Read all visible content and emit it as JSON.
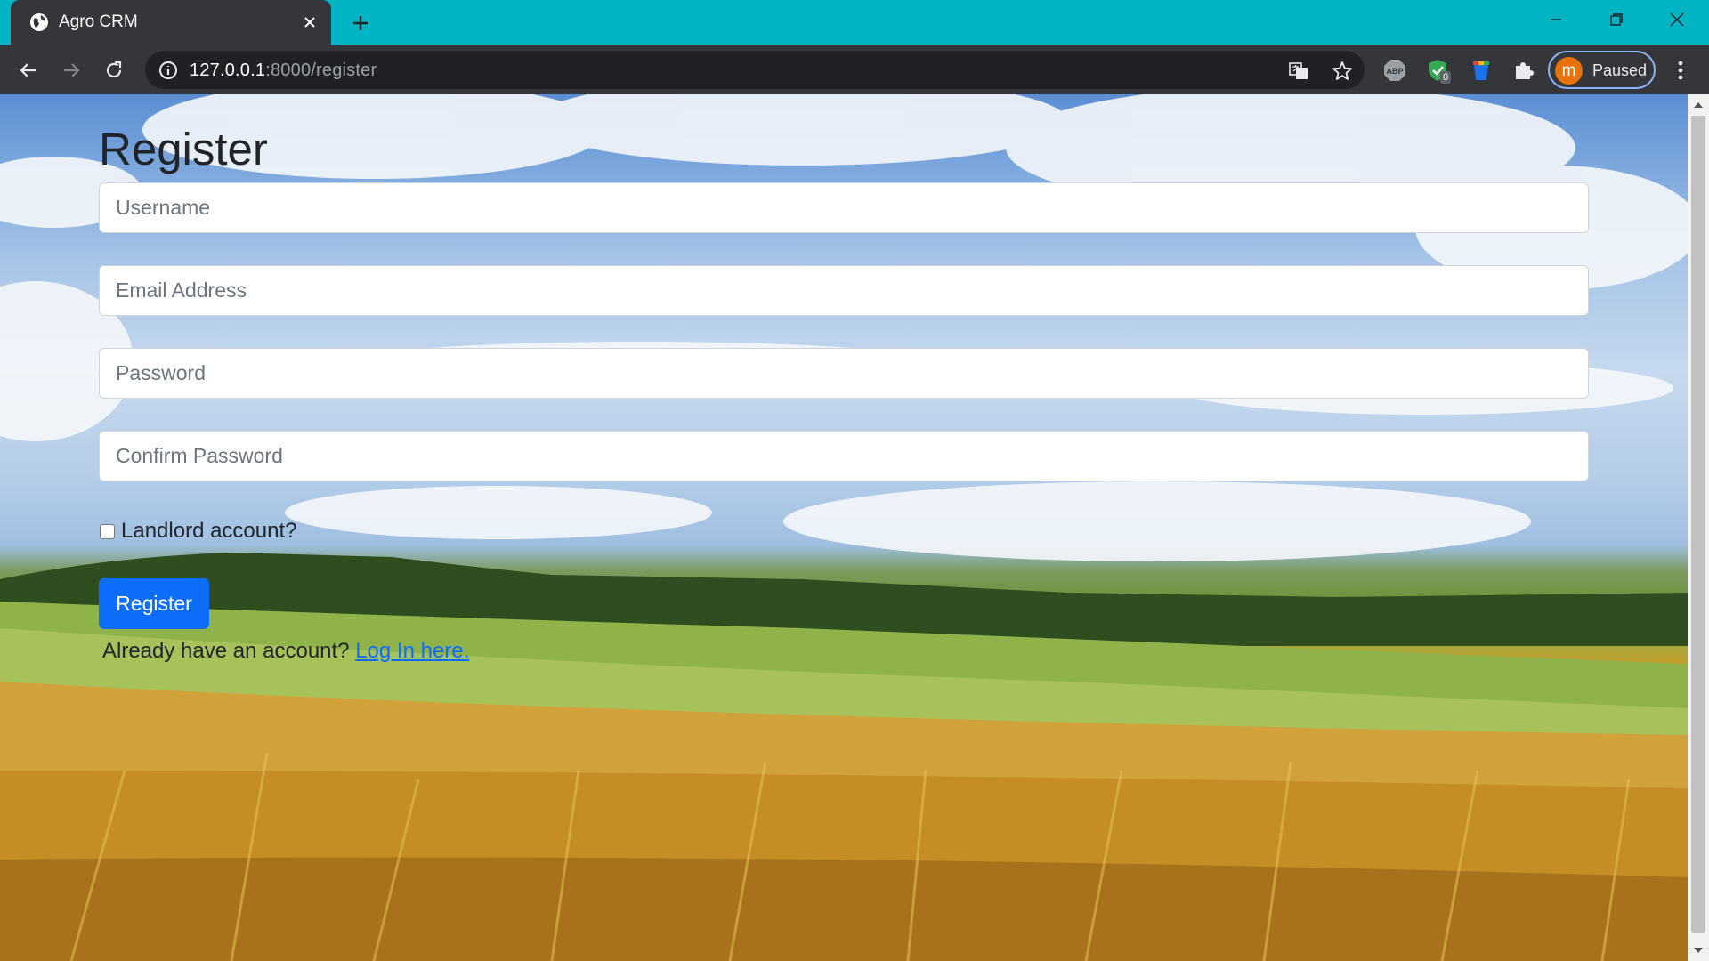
{
  "browser": {
    "tab_title": "Agro CRM",
    "url_host": "127.0.0.1",
    "url_path": ":8000/register",
    "profile_initial": "m",
    "profile_status": "Paused",
    "extension_badge": "0",
    "accent_color": "#01b4c4"
  },
  "page": {
    "title": "Register",
    "fields": {
      "username_placeholder": "Username",
      "email_placeholder": "Email Address",
      "password_placeholder": "Password",
      "confirm_placeholder": "Confirm Password"
    },
    "landlord_label": "Landlord account?",
    "landlord_checked": false,
    "register_button": "Register",
    "login_prompt": "Already have an account?",
    "login_link": "Log In here.",
    "primary_color": "#0d6efd"
  }
}
